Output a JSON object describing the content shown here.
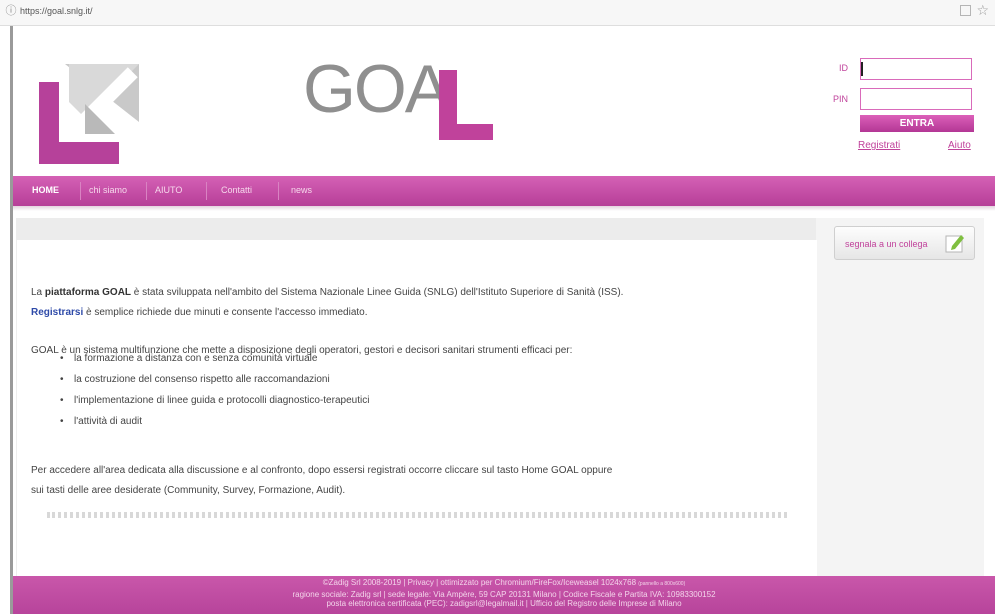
{
  "browser": {
    "url": "https://goal.snlg.it/"
  },
  "header": {
    "logo_text": "GOA",
    "login": {
      "id_label": "ID",
      "pin_label": "PIN",
      "id_value": "",
      "pin_value": "",
      "submit_label": "ENTRA",
      "register_link": "Registrati",
      "help_link": "Aiuto"
    }
  },
  "nav": {
    "items": [
      {
        "label": "HOME"
      },
      {
        "label": "chi siamo"
      },
      {
        "label": "AIUTO"
      },
      {
        "label": "Contatti"
      },
      {
        "label": "news"
      }
    ]
  },
  "sidebar": {
    "share_label": "segnala a un collega"
  },
  "main": {
    "intro": {
      "pre": "La ",
      "strong": "piattaforma GOAL",
      "post": " è stata sviluppata nell'ambito del Sistema Nazionale Linee Guida (SNLG) dell'Istituto Superiore di Sanità (ISS)."
    },
    "register": {
      "link": "Registrarsi",
      "post": " è semplice richiede due minuti e consente l'accesso immediato."
    },
    "goal_desc": "GOAL è un sistema multifunzione che mette a disposizione degli operatori, gestori e decisori sanitari strumenti efficaci per:",
    "bullets": [
      "la formazione a distanza con e senza comunità virtuale",
      "la costruzione del consenso rispetto alle raccomandazioni",
      "l'implementazione di linee guida e protocolli diagnostico-terapeutici",
      "l'attività di audit"
    ],
    "closing_line1": "Per accedere all'area dedicata alla discussione e al confronto, dopo essersi registrati occorre cliccare sul tasto Home GOAL oppure",
    "closing_line2": "sui tasti delle aree desiderate (Community, Survey, Formazione, Audit)."
  },
  "footer": {
    "line1_main": "©Zadig Srl 2008-2019 | Privacy | ottimizzato per Chromium/FireFox/Iceweasel 1024x768",
    "line1_small": "(pannello a 800x600)",
    "line2": "ragione sociale: Zadig srl | sede legale: Via Ampère, 59 CAP 20131 Milano | Codice Fiscale e Partita IVA: 10983300152",
    "line3": "posta elettronica certificata (PEC): zadigsrl@legalmail.it | Ufficio del Registro delle Imprese di Milano"
  },
  "colors": {
    "brand_magenta": "#c0429b",
    "nav_gradient_top": "#d561b5",
    "nav_gradient_bottom": "#b63e98",
    "logo_grey": "#8f8f8f"
  },
  "icons": {
    "browser_info": "info-icon",
    "bookmark": "bookmark-icon",
    "star": "star-icon",
    "share": "edit-icon"
  }
}
